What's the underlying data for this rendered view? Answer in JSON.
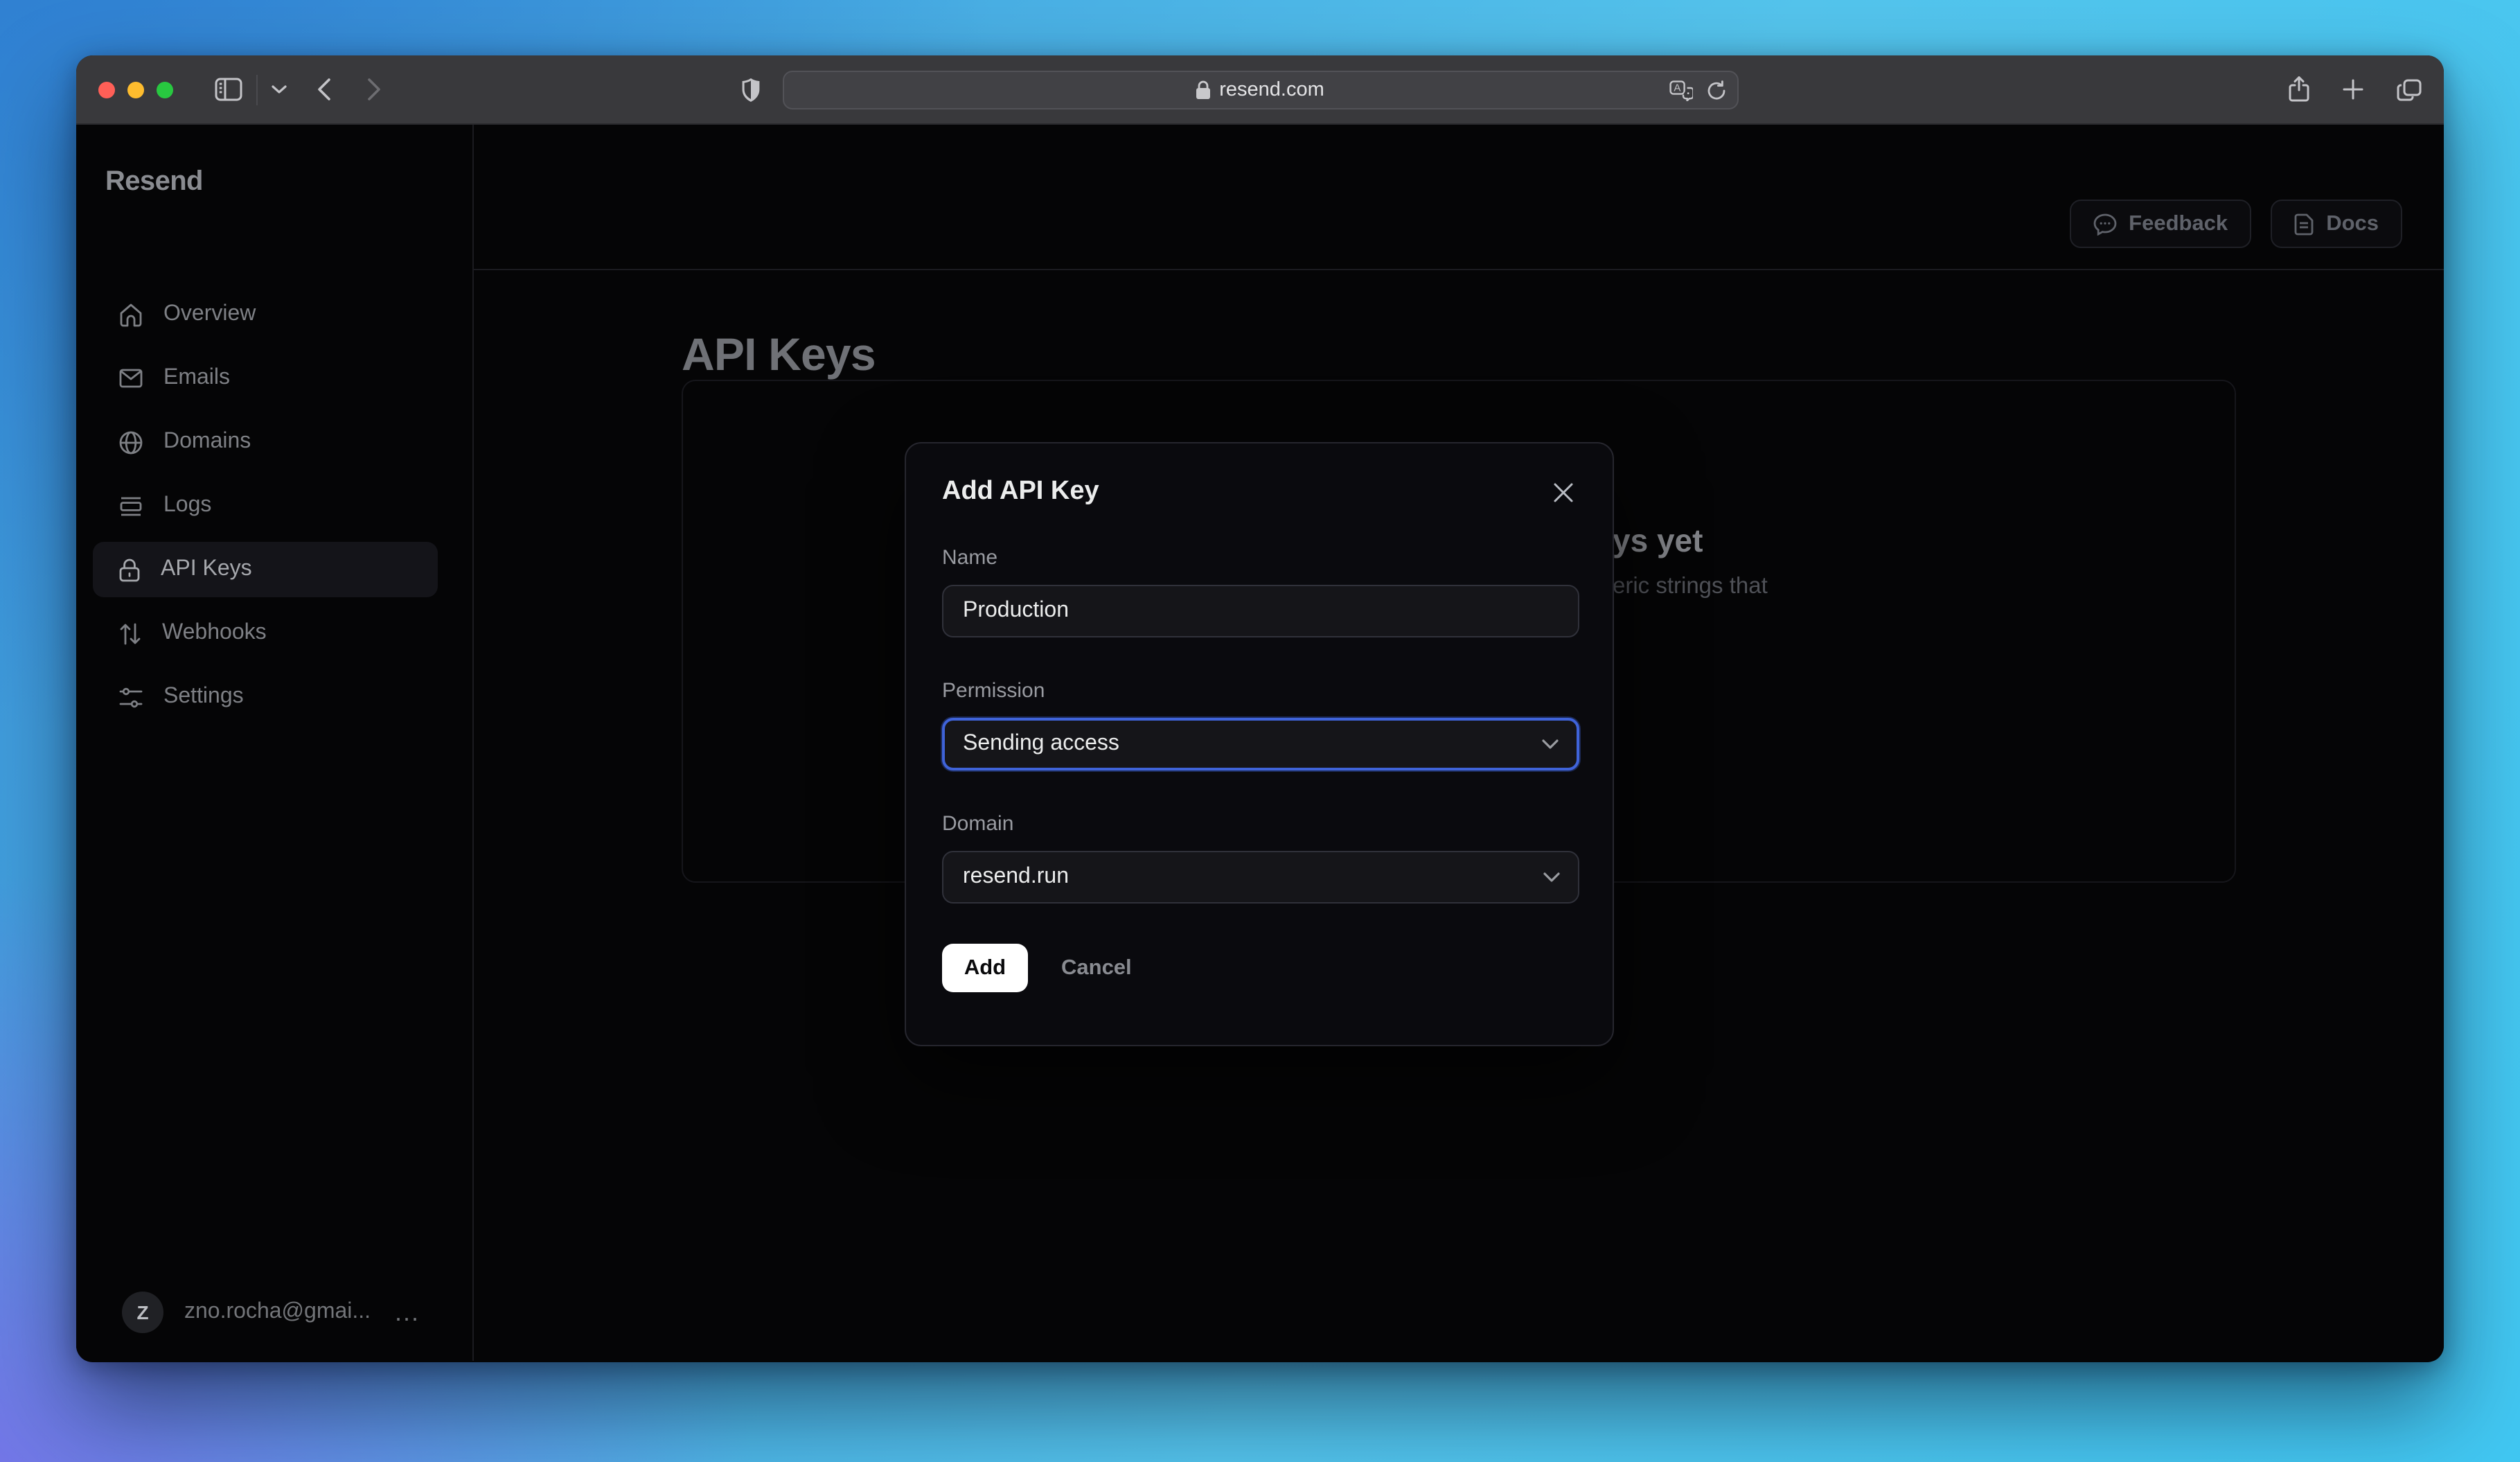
{
  "browser": {
    "url": "resend.com",
    "toolbar_icons": [
      "sidebar-toggle-icon",
      "chevron-down-icon",
      "back-icon",
      "forward-icon",
      "shield-icon",
      "lock-icon",
      "translate-icon",
      "reload-icon",
      "share-icon",
      "new-tab-icon",
      "tab-overview-icon"
    ]
  },
  "sidebar": {
    "logo": "Resend",
    "items": [
      {
        "label": "Overview",
        "icon": "home-icon",
        "active": false
      },
      {
        "label": "Emails",
        "icon": "mail-icon",
        "active": false
      },
      {
        "label": "Domains",
        "icon": "globe-icon",
        "active": false
      },
      {
        "label": "Logs",
        "icon": "logs-icon",
        "active": false
      },
      {
        "label": "API Keys",
        "icon": "lock-icon",
        "active": true
      },
      {
        "label": "Webhooks",
        "icon": "webhooks-icon",
        "active": false
      },
      {
        "label": "Settings",
        "icon": "settings-icon",
        "active": false
      }
    ],
    "account": {
      "avatar_letter": "Z",
      "email": "zno.rocha@gmai...",
      "more": "..."
    }
  },
  "header": {
    "feedback_label": "Feedback",
    "docs_label": "Docs"
  },
  "main": {
    "title": "API Keys",
    "empty_state": {
      "visible_heading_fragment": "ys yet",
      "visible_body_fragment": "eric strings that"
    }
  },
  "modal": {
    "title": "Add API Key",
    "name_label": "Name",
    "name_value": "Production",
    "permission_label": "Permission",
    "permission_value": "Sending access",
    "domain_label": "Domain",
    "domain_value": "resend.run",
    "add_label": "Add",
    "cancel_label": "Cancel"
  },
  "colors": {
    "focus_accent": "#3f63d9",
    "traffic_red": "#ff5f57",
    "traffic_yellow": "#febc2e",
    "traffic_green": "#28c840",
    "gradient_top_left": "#2e7ed1",
    "gradient_bottom_left": "#7b6fe8",
    "gradient_right": "#41c7f2",
    "window_bg": "#050506",
    "modal_bg": "#0a0a0e"
  }
}
